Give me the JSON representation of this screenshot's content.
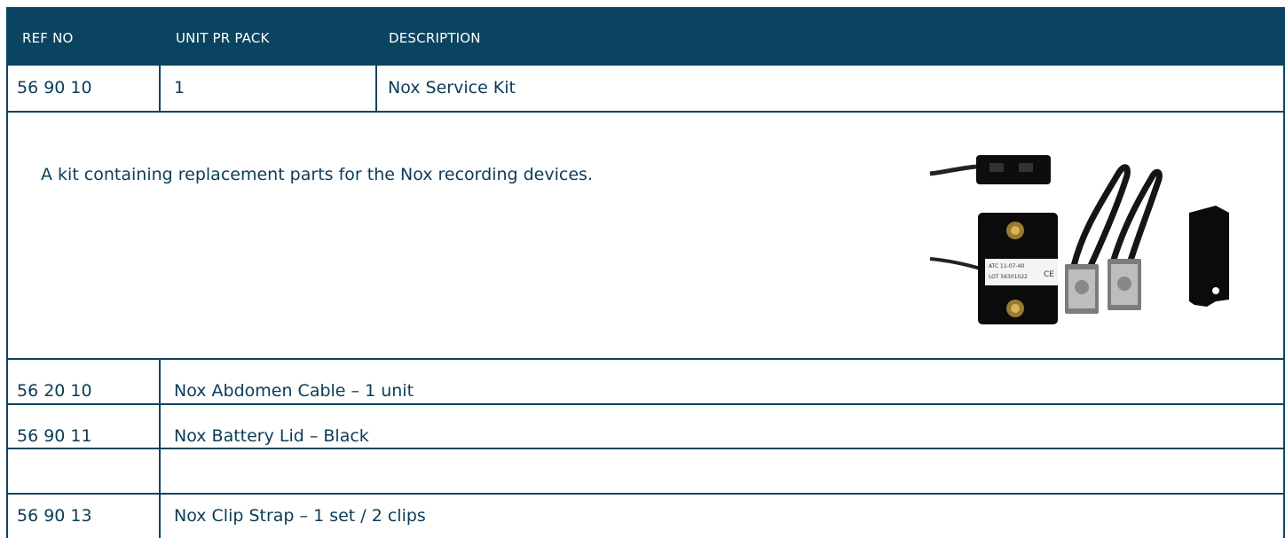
{
  "table": {
    "headers": [
      "REF NO",
      "UNIT PR PACK",
      "DESCRIPTION"
    ],
    "main_row": {
      "ref": "56 90 10",
      "units": "1",
      "description": "Nox Service Kit"
    },
    "info_text": "A kit containing replacement parts for the Nox recording devices.",
    "rows": [
      {
        "ref": "56 20 10",
        "description": "Nox Abdomen Cable – 1 unit"
      },
      {
        "ref": "56 90 11",
        "description": "Nox Battery Lid – Black"
      },
      {
        "ref": "56 90 13",
        "description": "Nox Clip Strap – 1 set / 2 clips"
      }
    ]
  },
  "image_labels": {
    "device_label_line1": "ATC 11-07-40",
    "device_label_line2": "LOT 56301022",
    "ce_mark": "CE"
  }
}
